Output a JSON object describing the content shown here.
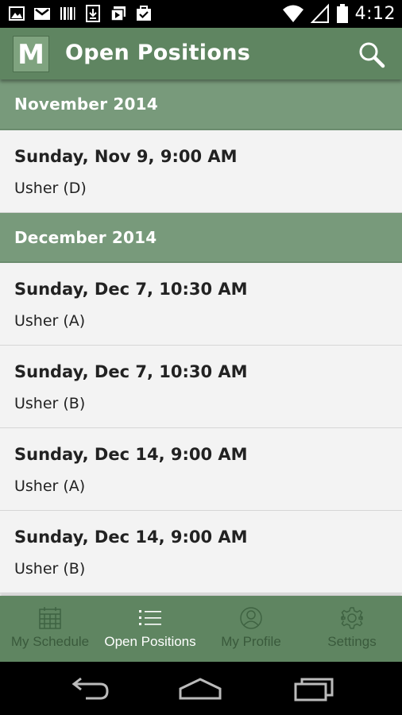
{
  "status_bar": {
    "time": "4:12",
    "left_icons": [
      "image-icon",
      "gmail-icon",
      "barcode-icon",
      "download-icon",
      "media-icon",
      "briefcase-check-icon"
    ],
    "right_icons": [
      "wifi-icon",
      "signal-icon",
      "battery-icon"
    ]
  },
  "app_bar": {
    "logo_letter": "M",
    "title": "Open Positions",
    "search_icon": "search-icon"
  },
  "groups": [
    {
      "month": "November 2014",
      "items": [
        {
          "date": "Sunday, Nov 9, 9:00 AM",
          "role": "Usher (D)"
        }
      ]
    },
    {
      "month": "December 2014",
      "items": [
        {
          "date": "Sunday, Dec 7, 10:30 AM",
          "role": "Usher (A)"
        },
        {
          "date": "Sunday, Dec 7, 10:30 AM",
          "role": "Usher (B)"
        },
        {
          "date": "Sunday, Dec 14, 9:00 AM",
          "role": "Usher (A)"
        },
        {
          "date": "Sunday, Dec 14, 9:00 AM",
          "role": "Usher (B)"
        }
      ]
    }
  ],
  "tabs": [
    {
      "label": "My Schedule",
      "icon": "calendar-icon",
      "active": false
    },
    {
      "label": "Open Positions",
      "icon": "list-icon",
      "active": true
    },
    {
      "label": "My Profile",
      "icon": "profile-icon",
      "active": false
    },
    {
      "label": "Settings",
      "icon": "gear-icon",
      "active": false
    }
  ],
  "nav_bar": {
    "buttons": [
      "back-icon",
      "home-icon",
      "recents-icon"
    ]
  },
  "colors": {
    "primary": "#5f8561",
    "section_header": "#789a7b",
    "tab_inactive_text": "#3a5a3c",
    "tab_active_text": "#ffffff",
    "list_bg": "#f3f3f3"
  }
}
